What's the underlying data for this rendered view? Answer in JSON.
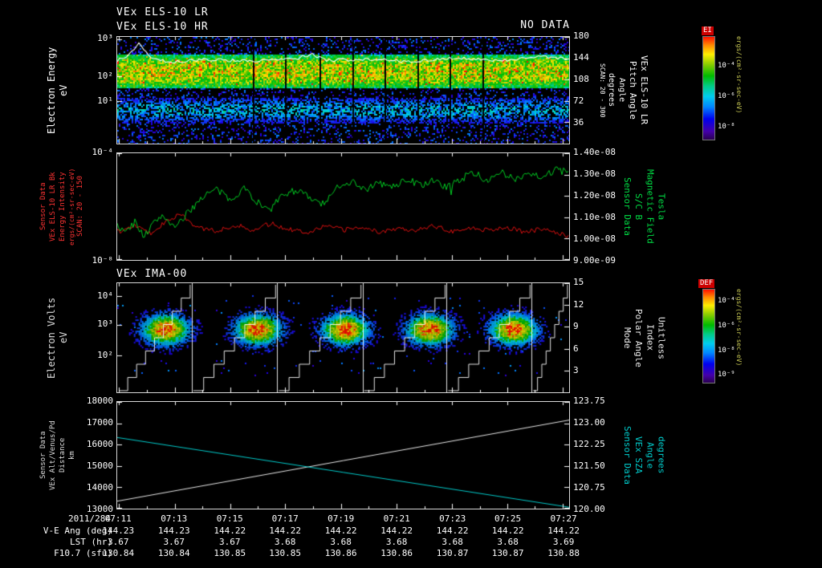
{
  "header": {
    "title_line1": "VEx ELS-10 LR",
    "title_line2": "VEx ELS-10 HR",
    "no_data": "NO DATA"
  },
  "colors": {
    "background": "#000000",
    "frame": "#d8d8d8",
    "red_series": "#e01010",
    "green_series": "#00cc22",
    "cyan_series": "#00cccc",
    "white_series": "#e8e8e8",
    "label_red": "#ff3333",
    "label_green": "#00dd44",
    "label_cyan": "#00cccc",
    "colorbar_units_color": "#cccc55"
  },
  "chart_data": [
    {
      "id": "els_spectrogram",
      "type": "heatmap",
      "title": "VEx ELS-10 LR",
      "subtitle": "VEx ELS-10 HR",
      "note": "NO DATA",
      "ylabel_cols": [
        "Electron Energy",
        "eV"
      ],
      "yaxis": {
        "scale": "log",
        "ticks": [
          "10³",
          "10²",
          "10¹"
        ],
        "ticks_pos": [
          0.02,
          0.37,
          0.6
        ]
      },
      "right_axis": {
        "ticks": [
          "180",
          "144",
          "108",
          "72",
          "36"
        ],
        "ticks_pos": [
          0.0,
          0.2,
          0.4,
          0.6,
          0.8
        ],
        "label_cols": [
          "SCAN: 20 - 300",
          "degrees",
          "Angle",
          "Pitch Angle",
          "VEx ELS-10 LR"
        ]
      },
      "colorbar": {
        "title": "EI",
        "ticks": [
          "10⁻⁴",
          "10⁻⁶",
          "10⁻⁸"
        ],
        "ticks_pos": [
          0.28,
          0.57,
          0.86
        ],
        "units": "ergs/(cm²-sr-sec-eV)"
      },
      "band": {
        "center_rel": 0.32,
        "width_rel": 0.14,
        "second_center_rel": 0.68,
        "second_width_rel": 0.1
      },
      "gap_lines_x_rel": [
        0.3,
        0.372,
        0.447,
        0.52,
        0.592,
        0.664,
        0.736,
        0.808
      ],
      "trace_anchors": [
        [
          0,
          0.22
        ],
        [
          0.02,
          0.18
        ],
        [
          0.04,
          0.1
        ],
        [
          0.05,
          0.06
        ],
        [
          0.06,
          0.13
        ],
        [
          0.08,
          0.2
        ],
        [
          0.12,
          0.24
        ],
        [
          0.2,
          0.21
        ],
        [
          0.3,
          0.23
        ],
        [
          0.4,
          0.2
        ],
        [
          0.43,
          0.16
        ],
        [
          0.46,
          0.22
        ],
        [
          0.55,
          0.21
        ],
        [
          0.65,
          0.23
        ],
        [
          0.75,
          0.2
        ],
        [
          0.85,
          0.22
        ],
        [
          0.93,
          0.18
        ],
        [
          1,
          0.21
        ]
      ]
    },
    {
      "id": "bfield_lines",
      "type": "line",
      "left_axis": {
        "scale": "log",
        "ticks": [
          "10⁻⁴",
          "10⁻⁸"
        ],
        "ticks_pos": [
          0.0,
          1.0
        ],
        "label_cols": [
          "Sensor Data",
          "VEx ELS-10 LR Bk",
          "Energy Intensity",
          "ergs/(cm²-sr-sec-eV)",
          "SCAN: 20 - 150"
        ],
        "label_color": "#ff3333"
      },
      "right_axis": {
        "ticks": [
          "1.40e-08",
          "1.30e-08",
          "1.20e-08",
          "1.10e-08",
          "1.00e-08",
          "9.00e-09"
        ],
        "ticks_pos": [
          0,
          0.2,
          0.4,
          0.6,
          0.8,
          1
        ],
        "range_e8": [
          1.4,
          0.9
        ],
        "label_cols": [
          "Sensor Data",
          "S/C B",
          "Magnetic Field",
          "Tesla"
        ],
        "label_color": "#00dd44"
      },
      "series": [
        {
          "name": "sc_b_magnetic_field_tesla",
          "color": "#00cc22",
          "axis": "right",
          "x_rel": [
            0,
            0.02,
            0.04,
            0.06,
            0.08,
            0.1,
            0.13,
            0.16,
            0.19,
            0.22,
            0.25,
            0.28,
            0.31,
            0.34,
            0.37,
            0.4,
            0.43,
            0.46,
            0.49,
            0.52,
            0.55,
            0.58,
            0.61,
            0.64,
            0.67,
            0.7,
            0.73,
            0.76,
            0.79,
            0.82,
            0.85,
            0.88,
            0.91,
            0.94,
            0.97,
            1.0
          ],
          "values_e8": [
            1.06,
            1.03,
            1.08,
            1.01,
            1.07,
            1.11,
            1.05,
            1.13,
            1.2,
            1.23,
            1.18,
            1.24,
            1.17,
            1.14,
            1.21,
            1.23,
            1.18,
            1.16,
            1.25,
            1.27,
            1.23,
            1.26,
            1.24,
            1.28,
            1.25,
            1.27,
            1.24,
            1.28,
            1.31,
            1.27,
            1.3,
            1.28,
            1.31,
            1.29,
            1.32,
            1.31
          ]
        },
        {
          "name": "els_bk_energy_intensity",
          "color": "#e01010",
          "axis": "left",
          "x_rel": [
            0,
            0.04,
            0.08,
            0.11,
            0.14,
            0.18,
            0.22,
            0.26,
            0.3,
            0.34,
            0.38,
            0.42,
            0.46,
            0.5,
            0.54,
            0.58,
            0.62,
            0.66,
            0.7,
            0.74,
            0.78,
            0.82,
            0.86,
            0.9,
            0.94,
            1.0
          ],
          "y_rel": [
            0.74,
            0.68,
            0.76,
            0.62,
            0.58,
            0.7,
            0.73,
            0.67,
            0.72,
            0.66,
            0.71,
            0.74,
            0.68,
            0.72,
            0.69,
            0.74,
            0.7,
            0.72,
            0.68,
            0.73,
            0.7,
            0.72,
            0.69,
            0.74,
            0.71,
            0.78
          ]
        }
      ]
    },
    {
      "id": "ima_spectrogram",
      "type": "heatmap",
      "title": "VEx IMA-00",
      "ylabel_cols": [
        "Electron Volts",
        "eV"
      ],
      "yaxis": {
        "scale": "log",
        "ticks": [
          "10⁴",
          "10³",
          "10²"
        ],
        "ticks_pos": [
          0.12,
          0.38,
          0.66
        ]
      },
      "right_axis": {
        "ticks": [
          "15",
          "12",
          "9",
          "6",
          "3"
        ],
        "ticks_pos": [
          0,
          0.2,
          0.4,
          0.6,
          0.8
        ],
        "label_cols": [
          "Mode",
          "Polar Angle",
          "Index",
          "Unitless"
        ]
      },
      "colorbar": {
        "title": "DEF",
        "ticks": [
          "10⁻⁴",
          "10⁻⁶",
          "10⁻⁸",
          "10⁻⁹"
        ],
        "ticks_pos": [
          0.12,
          0.38,
          0.64,
          0.9
        ],
        "units": "ergs/(cm²-sr-sec-eV)"
      },
      "blobs_x_rel": [
        0.106,
        0.31,
        0.504,
        0.69,
        0.876
      ],
      "blobs_y_rel": 0.42,
      "segment_bounds_rel": [
        0,
        0.165,
        0.354,
        0.543,
        0.729,
        0.917,
        1.0
      ]
    },
    {
      "id": "ephemeris_lines",
      "type": "line",
      "left_axis": {
        "ticks": [
          "18000",
          "17000",
          "16000",
          "15000",
          "14000",
          "13000"
        ],
        "ticks_pos": [
          0,
          0.2,
          0.4,
          0.6,
          0.8,
          1
        ],
        "range": [
          18000,
          13000
        ],
        "label_cols": [
          "Sensor Data",
          "VEx Alt/Venus/Pd",
          "Distance",
          "km"
        ],
        "label_color": "#dddddd"
      },
      "right_axis": {
        "ticks": [
          "123.75",
          "123.00",
          "122.25",
          "121.50",
          "120.75",
          "120.00"
        ],
        "ticks_pos": [
          0,
          0.2,
          0.4,
          0.6,
          0.8,
          1
        ],
        "range": [
          123.75,
          120.0
        ],
        "label_cols": [
          "Sensor Data",
          "VEx SZA",
          "Angle",
          "degrees"
        ],
        "label_color": "#00cccc"
      },
      "series": [
        {
          "name": "vex_altitude_km",
          "color": "#e8e8e8",
          "axis": "left",
          "points": [
            [
              0,
              13350
            ],
            [
              1,
              17150
            ]
          ]
        },
        {
          "name": "vex_sza_degrees",
          "color": "#00cccc",
          "axis": "right",
          "points": [
            [
              0,
              122.5
            ],
            [
              1,
              120.05
            ]
          ]
        }
      ]
    }
  ],
  "bottom_axis": {
    "date_label": "2011/284",
    "time_ticks": [
      "07:11",
      "07:13",
      "07:15",
      "07:17",
      "07:19",
      "07:21",
      "07:23",
      "07:25",
      "07:27"
    ],
    "tick_xs_rel": [
      0.004,
      0.127,
      0.25,
      0.372,
      0.495,
      0.618,
      0.741,
      0.863,
      0.986
    ],
    "rows": [
      {
        "label": "V-E Ang (deg)",
        "values": [
          "144.23",
          "144.23",
          "144.22",
          "144.22",
          "144.22",
          "144.22",
          "144.22",
          "144.22",
          "144.22"
        ]
      },
      {
        "label": "LST (hr)",
        "values": [
          "3.67",
          "3.67",
          "3.67",
          "3.68",
          "3.68",
          "3.68",
          "3.68",
          "3.68",
          "3.69"
        ]
      },
      {
        "label": "F10.7 (sfu)",
        "values": [
          "130.84",
          "130.84",
          "130.85",
          "130.85",
          "130.86",
          "130.86",
          "130.87",
          "130.87",
          "130.88"
        ]
      }
    ]
  }
}
